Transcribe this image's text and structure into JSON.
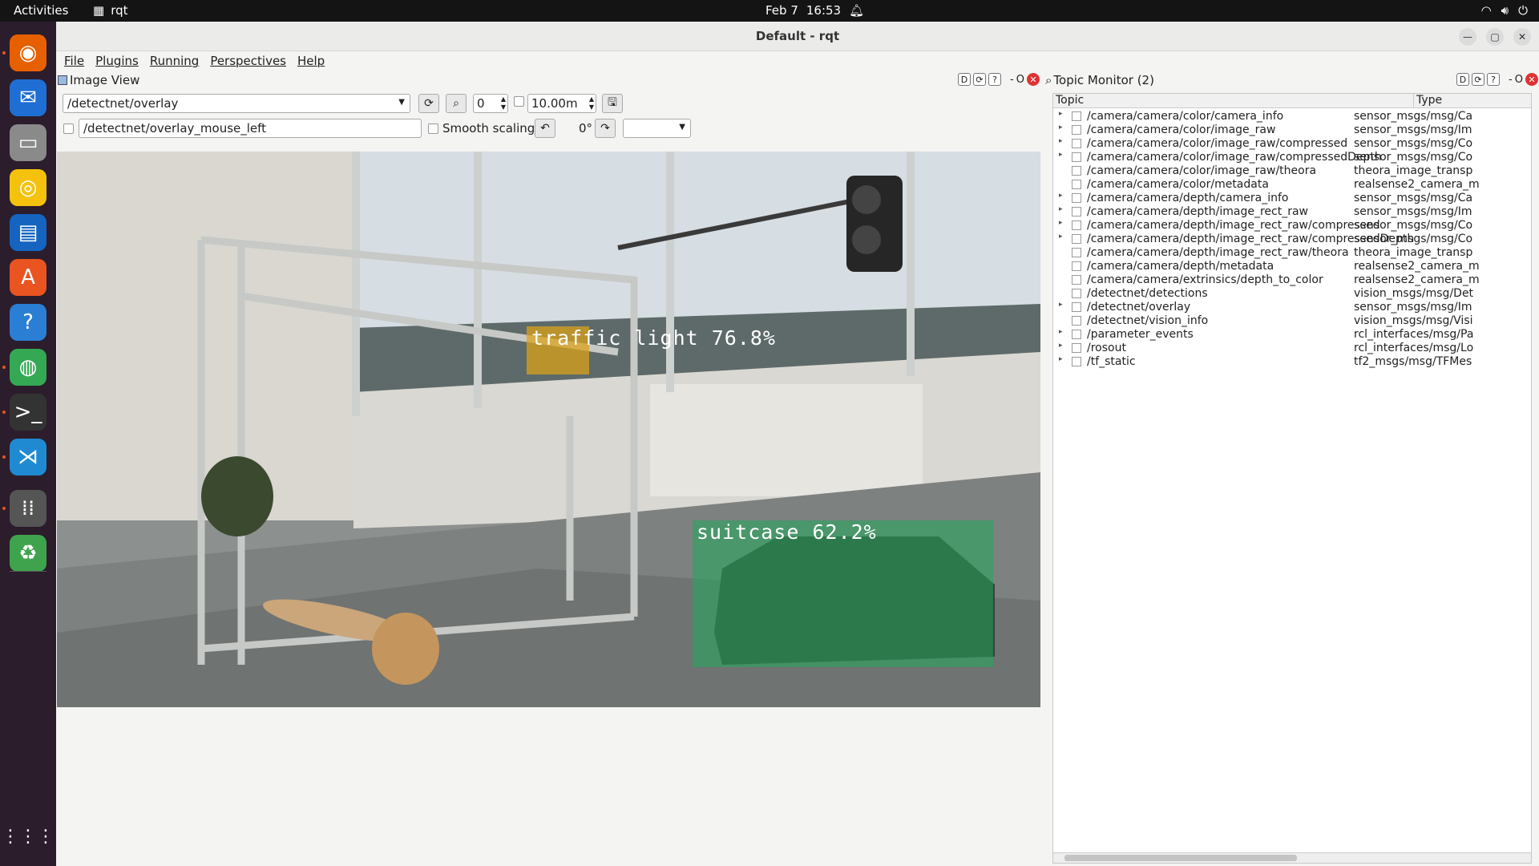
{
  "topbar": {
    "activities": "Activities",
    "app_name": "rqt",
    "date": "Feb 7",
    "time": "16:53"
  },
  "window": {
    "title": "Default - rqt"
  },
  "menu": [
    "File",
    "Plugins",
    "Running",
    "Perspectives",
    "Help"
  ],
  "image_view": {
    "title": "Image View",
    "topic_value": "/detectnet/overlay",
    "zoom_value": "0",
    "duration_value": "10.00m",
    "mouse_topic_value": "/detectnet/overlay_mouse_left",
    "smooth_scaling_label": "Smooth scaling",
    "rotation_label": "0°",
    "detections": [
      {
        "label": "traffic light 76.8%",
        "color": "#d9a21a"
      },
      {
        "label": "suitcase 62.2%",
        "color": "#1faa59"
      }
    ]
  },
  "topic_monitor": {
    "title": "Topic Monitor (2)",
    "columns": [
      "Topic",
      "Type"
    ],
    "rows": [
      {
        "expandable": true,
        "topic": "/camera/camera/color/camera_info",
        "type": "sensor_msgs/msg/Ca"
      },
      {
        "expandable": true,
        "topic": "/camera/camera/color/image_raw",
        "type": "sensor_msgs/msg/Im"
      },
      {
        "expandable": true,
        "topic": "/camera/camera/color/image_raw/compressed",
        "type": "sensor_msgs/msg/Co"
      },
      {
        "expandable": true,
        "topic": "/camera/camera/color/image_raw/compressedDepth",
        "type": "sensor_msgs/msg/Co"
      },
      {
        "expandable": false,
        "topic": "/camera/camera/color/image_raw/theora",
        "type": "theora_image_transp"
      },
      {
        "expandable": false,
        "topic": "/camera/camera/color/metadata",
        "type": "realsense2_camera_m"
      },
      {
        "expandable": true,
        "topic": "/camera/camera/depth/camera_info",
        "type": "sensor_msgs/msg/Ca"
      },
      {
        "expandable": true,
        "topic": "/camera/camera/depth/image_rect_raw",
        "type": "sensor_msgs/msg/Im"
      },
      {
        "expandable": true,
        "topic": "/camera/camera/depth/image_rect_raw/compressed",
        "type": "sensor_msgs/msg/Co"
      },
      {
        "expandable": true,
        "topic": "/camera/camera/depth/image_rect_raw/compressedDepth",
        "type": "sensor_msgs/msg/Co"
      },
      {
        "expandable": false,
        "topic": "/camera/camera/depth/image_rect_raw/theora",
        "type": "theora_image_transp"
      },
      {
        "expandable": false,
        "topic": "/camera/camera/depth/metadata",
        "type": "realsense2_camera_m"
      },
      {
        "expandable": false,
        "topic": "/camera/camera/extrinsics/depth_to_color",
        "type": "realsense2_camera_m"
      },
      {
        "expandable": false,
        "topic": "/detectnet/detections",
        "type": "vision_msgs/msg/Det"
      },
      {
        "expandable": true,
        "topic": "/detectnet/overlay",
        "type": "sensor_msgs/msg/Im"
      },
      {
        "expandable": false,
        "topic": "/detectnet/vision_info",
        "type": "vision_msgs/msg/Visi"
      },
      {
        "expandable": true,
        "topic": "/parameter_events",
        "type": "rcl_interfaces/msg/Pa"
      },
      {
        "expandable": true,
        "topic": "/rosout",
        "type": "rcl_interfaces/msg/Lo"
      },
      {
        "expandable": true,
        "topic": "/tf_static",
        "type": "tf2_msgs/msg/TFMes"
      }
    ]
  },
  "dock": [
    {
      "icon": "firefox-icon",
      "color": "#e66000",
      "running": true
    },
    {
      "icon": "thunderbird-icon",
      "color": "#1f6ed4",
      "running": false
    },
    {
      "icon": "files-icon",
      "color": "#8a8a8a",
      "running": false
    },
    {
      "icon": "rhythmbox-icon",
      "color": "#f4c20d",
      "running": false
    },
    {
      "icon": "writer-icon",
      "color": "#1565c0",
      "running": false
    },
    {
      "icon": "software-icon",
      "color": "#e95420",
      "running": false
    },
    {
      "icon": "help-icon",
      "color": "#2a7fd4",
      "running": false
    },
    {
      "icon": "chrome-icon",
      "color": "#34a853",
      "running": true
    },
    {
      "icon": "terminal-icon",
      "color": "#333333",
      "running": true
    },
    {
      "icon": "vscode-icon",
      "color": "#1f8ad2",
      "running": true
    },
    {
      "icon": "rqt-icon",
      "color": "#555555",
      "running": true
    },
    {
      "icon": "trash-icon",
      "color": "#3fa34d",
      "running": false
    }
  ]
}
